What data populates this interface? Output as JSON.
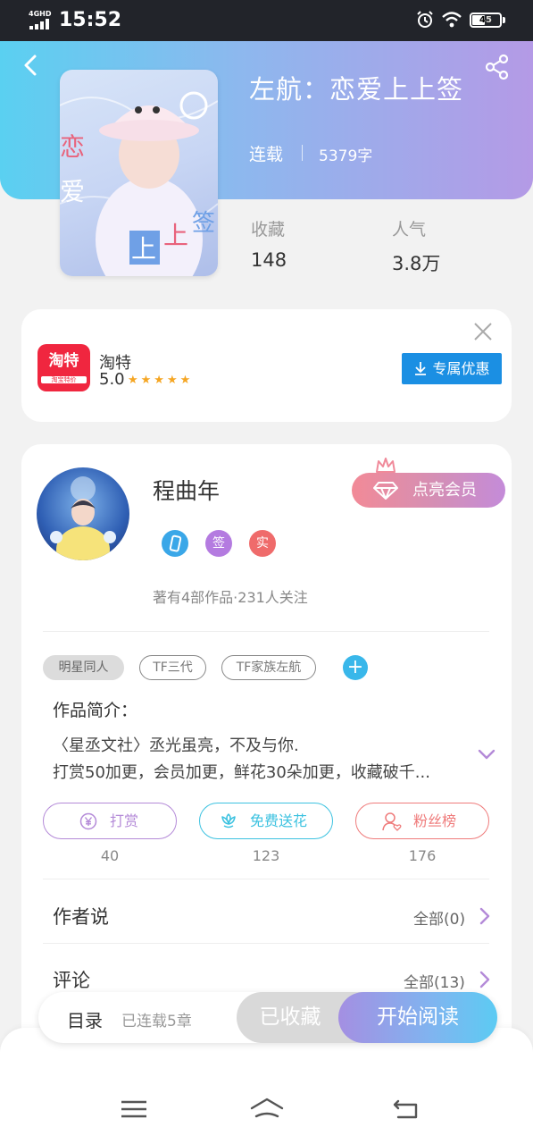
{
  "status_bar": {
    "network": "4GHD",
    "time": "15:52",
    "battery": "45",
    "battery_level": 0.45
  },
  "book": {
    "title": "左航：恋爱上上签",
    "status": "连载",
    "word_count": "5379字",
    "cover_text": [
      "恋",
      "爱",
      "上",
      "上",
      "签"
    ],
    "stats": [
      {
        "label": "收藏",
        "value": "148"
      },
      {
        "label": "人气",
        "value": "3.8万"
      }
    ]
  },
  "ad": {
    "app_name": "淘特",
    "rating": "5.0",
    "stars": "★★★★★",
    "logo_text": "淘特",
    "logo_sub": "淘宝特价",
    "cta": "专属优惠"
  },
  "author": {
    "name": "程曲年",
    "vip_button": "点亮会员",
    "badges": [
      {
        "icon": "phone-badge-icon",
        "text": "",
        "color": "#3aa7e8"
      },
      {
        "icon": "sign-badge-icon",
        "text": "签",
        "color": "#b47be0"
      },
      {
        "icon": "verified-badge-icon",
        "text": "实",
        "color": "#ef6b6b"
      }
    ],
    "meta": "著有4部作品·231人关注"
  },
  "tags": [
    "明星同人",
    "TF三代",
    "TF家族左航"
  ],
  "intro": {
    "title": "作品简介：",
    "lines": [
      "〈星丞文社〉丞光虽亮，不及与你.",
      "打赏50加更，会员加更，鲜花30朵加更，收藏破千..."
    ]
  },
  "actions": [
    {
      "label": "打赏",
      "count": "40",
      "color": "#b48ad8",
      "icon": "yen-icon"
    },
    {
      "label": "免费送花",
      "count": "123",
      "color": "#3cc2e0",
      "icon": "flower-icon"
    },
    {
      "label": "粉丝榜",
      "count": "176",
      "color": "#ef7b7b",
      "icon": "fans-icon"
    }
  ],
  "sections": [
    {
      "title": "作者说",
      "link": "全部(0)"
    },
    {
      "title": "评论",
      "link": "全部(13)"
    }
  ],
  "bottom_bar": {
    "toc": "目录",
    "toc_sub": "已连载5章",
    "collected": "已收藏",
    "read": "开始阅读"
  },
  "colors": {
    "header_gradient": [
      "#5ad0f1",
      "#b49ae6"
    ],
    "ad_button": "#1b8fe3",
    "tag_add": "#39b7ea"
  }
}
